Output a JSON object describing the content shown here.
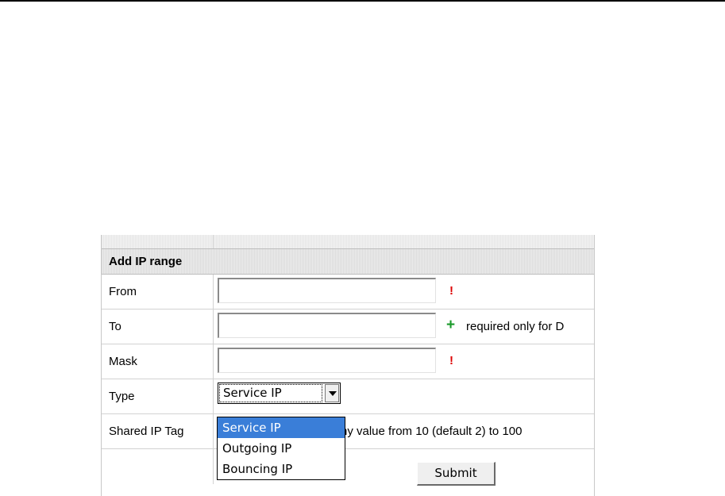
{
  "form": {
    "title": "Add IP range",
    "required_marker": "!",
    "optional_marker": "+",
    "fields": {
      "from": {
        "label": "From",
        "value": ""
      },
      "to": {
        "label": "To",
        "value": "",
        "note": "required only for D"
      },
      "mask": {
        "label": "Mask",
        "value": ""
      },
      "type": {
        "label": "Type",
        "selected": "Service IP",
        "options": [
          "Service IP",
          "Outgoing IP",
          "Bouncing IP"
        ]
      },
      "shared_ip_tag": {
        "label": "Shared IP Tag",
        "note": "ny value from 10 (default 2) to 100"
      }
    },
    "submit_label": "Submit"
  },
  "colors": {
    "required": "#dd0000",
    "optional": "#1a9a2a",
    "selection": "#3a7ed8"
  }
}
